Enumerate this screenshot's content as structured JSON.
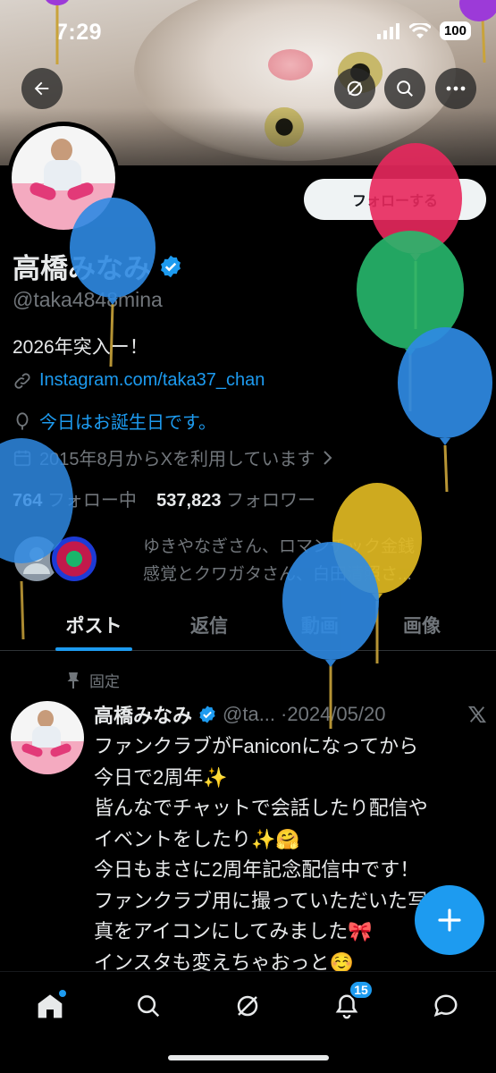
{
  "status_bar": {
    "time": "7:29",
    "battery": "100"
  },
  "profile": {
    "follow_label": "フォローする",
    "name": "高橋みなみ",
    "handle": "@taka4848mina",
    "bio": "2026年突入ー！",
    "link": "Instagram.com/taka37_chan",
    "birthday": "今日はお誕生日です。",
    "joined": "2015年8月からXを利用しています",
    "following_count": "764",
    "following_label": "フォロー中",
    "followers_count": "537,823",
    "followers_label": "フォロワー",
    "mutuals_line1": "ゆきやなぎさん、ロマンチック金銭",
    "mutuals_line2": "感覚とクワガタさん、白田清照さ..."
  },
  "tabs": [
    {
      "label": "ポスト",
      "active": true
    },
    {
      "label": "返信"
    },
    {
      "label": "動画"
    },
    {
      "label": "画像"
    }
  ],
  "pinned_tweet": {
    "pinned_label": "固定",
    "name": "高橋みなみ",
    "handle": "@ta...",
    "date": "·2024/05/20",
    "lines": [
      "ファンクラブがFaniconになってから",
      "今日で2周年✨",
      "皆んなでチャットで会話したり配信や",
      "イベントをしたり✨🤗",
      "今日もまさに2周年記念配信中です！",
      "ファンクラブ用に撮っていただいた写",
      "真をアイコンにしてみました🎀",
      "インスタも変えちゃおっと☺️"
    ]
  },
  "bottom_nav": {
    "notifications_badge": "15"
  },
  "colors": {
    "accent": "#1d9bf0",
    "background": "#000000",
    "text": "#e7e9ea",
    "muted": "#71767b"
  },
  "icons": [
    "back-arrow-icon",
    "grok-icon",
    "search-icon",
    "more-icon",
    "verified-badge-icon",
    "link-icon",
    "birthday-icon",
    "calendar-icon",
    "pin-icon",
    "x-logo-icon",
    "compose-icon",
    "home-icon",
    "notifications-icon",
    "messages-icon"
  ]
}
